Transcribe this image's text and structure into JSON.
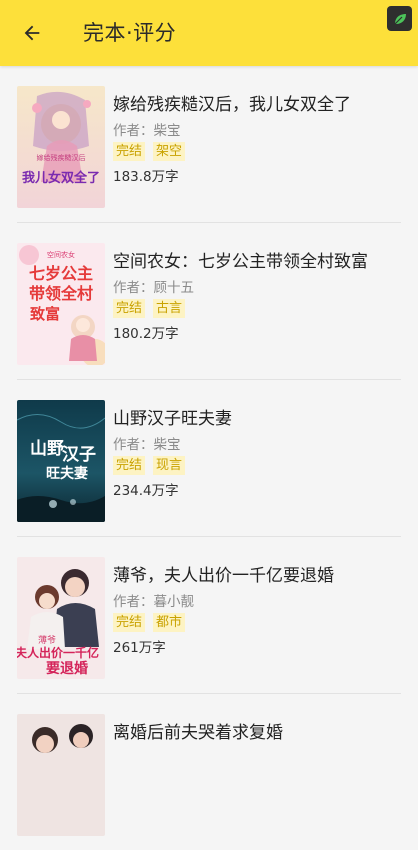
{
  "header": {
    "title": "完本·评分",
    "accent_color": "#fde03a"
  },
  "books": [
    {
      "title": "嫁给残疾糙汉后，我儿女双全了",
      "author": "作者：柴宝",
      "tags": [
        "完结",
        "架空"
      ],
      "words": "183.8万字",
      "cover_text": "我儿女双全了",
      "cover_sub": "嫁给残疾糙汉后"
    },
    {
      "title": "空间农女：七岁公主带领全村致富",
      "author": "作者：顾十五",
      "tags": [
        "完结",
        "古言"
      ],
      "words": "180.2万字",
      "cover_text": "七岁公主带领全村致富",
      "cover_sub": "空间农女"
    },
    {
      "title": "山野汉子旺夫妻",
      "author": "作者：柴宝",
      "tags": [
        "完结",
        "现言"
      ],
      "words": "234.4万字",
      "cover_text": "山野汉子旺夫妻",
      "cover_sub": ""
    },
    {
      "title": "薄爷，夫人出价一千亿要退婚",
      "author": "作者：暮小靓",
      "tags": [
        "完结",
        "都市"
      ],
      "words": "261万字",
      "cover_text": "夫人出价一千亿要退婚",
      "cover_sub": "薄爷"
    },
    {
      "title": "离婚后前夫哭着求复婚",
      "author": "",
      "tags": [],
      "words": "",
      "cover_text": "",
      "cover_sub": ""
    }
  ]
}
